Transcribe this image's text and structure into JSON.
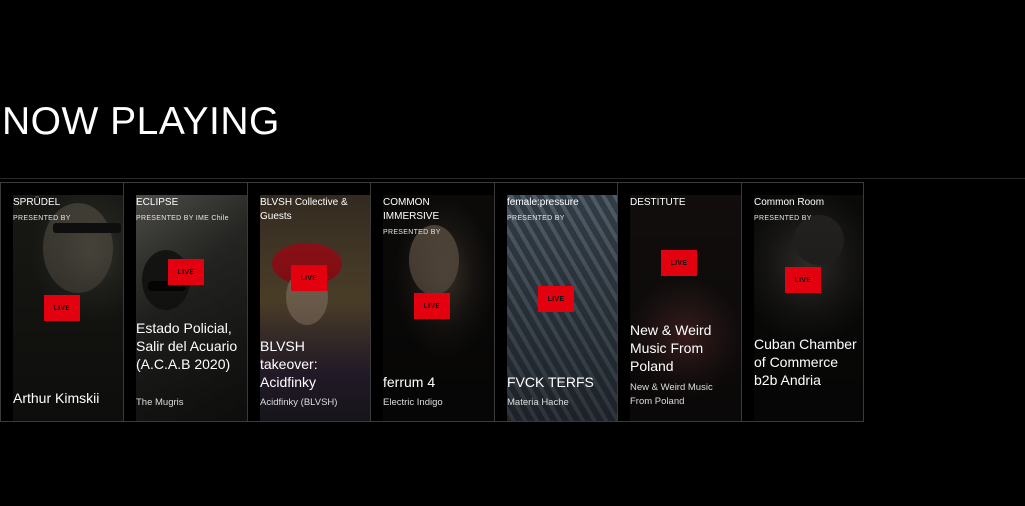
{
  "page": {
    "title": "NOW PLAYING"
  },
  "cards": [
    {
      "brand": "SPRÜDEL",
      "presented": "PRESENTED BY",
      "show": "",
      "artist": "Arthur Kimskii",
      "artist_style": "large",
      "live": "LIVE"
    },
    {
      "brand": "ECLIPSE",
      "presented": "PRESENTED BY IME Chile",
      "show": "Estado Policial, Salir del Acuario (A.C.A.B 2020)",
      "artist": "The Mugris",
      "live": "LIVE"
    },
    {
      "brand": "BLVSH Collective & Guests",
      "presented": "",
      "show": "BLVSH takeover: Acidfinky",
      "artist": "Acidfinky (BLVSH)",
      "live": "LIVE"
    },
    {
      "brand": "COMMON IMMERSIVE",
      "presented": "PRESENTED BY",
      "show": "ferrum 4",
      "artist": "Electric Indigo",
      "live": "LIVE"
    },
    {
      "brand": "female:pressure",
      "presented": "PRESENTED BY",
      "show": "FVCK TERFS",
      "artist": "Materia Hache",
      "live": "LIVE"
    },
    {
      "brand": "DESTITUTE",
      "presented": "",
      "show": "New & Weird Music From Poland",
      "artist": "New & Weird Music From Poland",
      "live": "LIVE"
    },
    {
      "brand": "Common Room",
      "presented": "PRESENTED BY",
      "show": "Cuban Chamber of Commerce b2b Andria",
      "artist": "",
      "live": "LIVE"
    }
  ]
}
